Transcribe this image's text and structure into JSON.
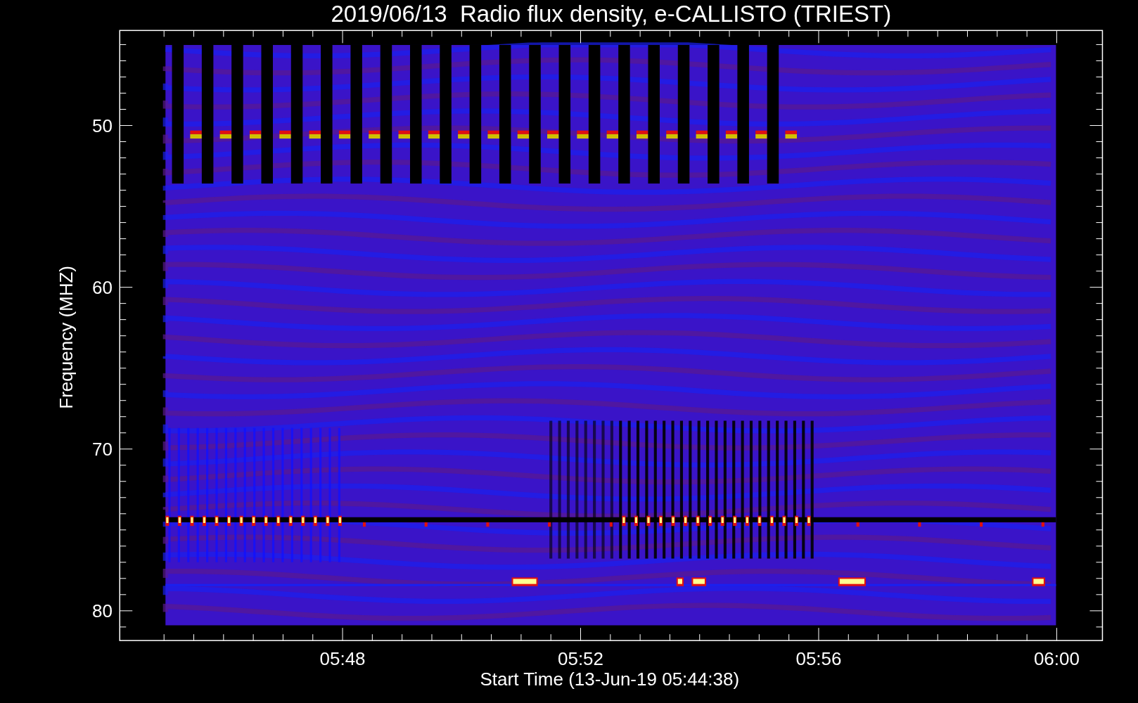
{
  "title": "2019/06/13  Radio flux density, e-CALLISTO (TRIEST)",
  "y_axis": {
    "label": "Frequency (MHZ)",
    "ticks": [
      "50",
      "60",
      "70",
      "80"
    ]
  },
  "x_axis": {
    "label": "Start Time (13-Jun-19 05:44:38)",
    "ticks": [
      "05:48",
      "05:52",
      "05:56",
      "06:00"
    ]
  }
}
